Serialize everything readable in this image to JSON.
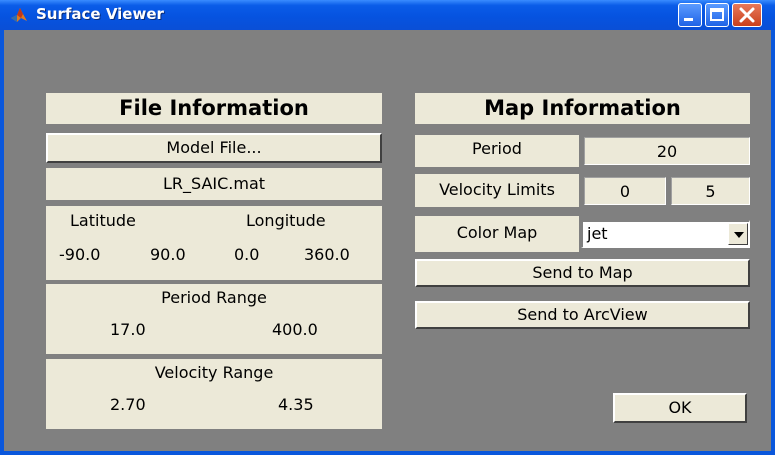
{
  "window": {
    "title": "Surface Viewer"
  },
  "file_info": {
    "heading": "File Information",
    "model_file_button": "Model File...",
    "filename": "LR_SAIC.mat",
    "coords": {
      "latitude_label": "Latitude",
      "longitude_label": "Longitude",
      "lat_min": "-90.0",
      "lat_max": "90.0",
      "lon_min": "0.0",
      "lon_max": "360.0"
    },
    "period_range": {
      "label": "Period Range",
      "min": "17.0",
      "max": "400.0"
    },
    "velocity_range": {
      "label": "Velocity Range",
      "min": "2.70",
      "max": "4.35"
    }
  },
  "map_info": {
    "heading": "Map Information",
    "period_label": "Period",
    "period_value": "20",
    "velocity_limits_label": "Velocity Limits",
    "velocity_min": "0",
    "velocity_max": "5",
    "color_map_label": "Color Map",
    "color_map_value": "jet",
    "send_to_map_button": "Send to Map",
    "send_to_arcview_button": "Send to ArcView"
  },
  "ok_button": "OK",
  "icons": {
    "app": "matlab-logo-icon",
    "minimize": "minimize-icon",
    "maximize": "maximize-icon",
    "close": "close-icon",
    "dropdown": "chevron-down-icon"
  },
  "colors": {
    "titlebar": "#0a5ce8",
    "client_bg": "#808080",
    "panel_bg": "#ece9d8",
    "close_button": "#c9401c"
  }
}
